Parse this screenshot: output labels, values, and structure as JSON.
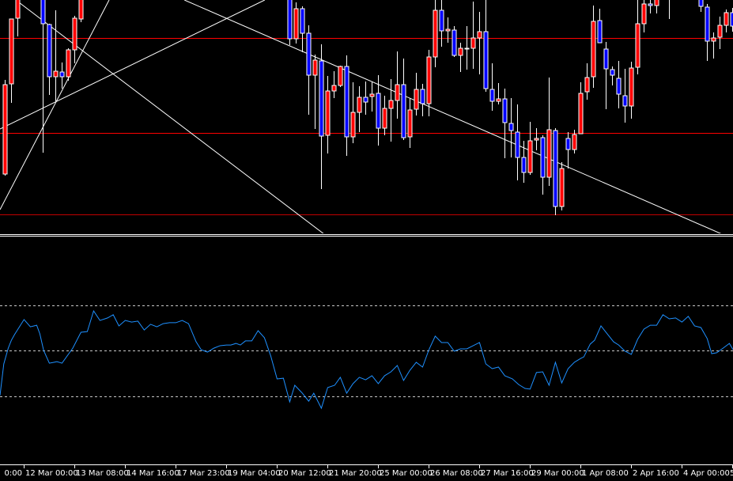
{
  "chart_data": [
    {
      "type": "candlestick",
      "title": "",
      "note": "prices in relative units (no price scale visible); bars indexed left to right",
      "colors": {
        "bull": "#ff0000",
        "bear": "#0000ff",
        "wick": "#ffffff",
        "outline": "#ffffff",
        "background": "#000000"
      },
      "ylim": [
        0,
        300
      ],
      "candles": [
        [
          0,
          80,
          199,
          78,
          193
        ],
        [
          1,
          194,
          276,
          170,
          276
        ],
        [
          2,
          277,
          310,
          254,
          305
        ],
        [
          6,
          310,
          315,
          107,
          270
        ],
        [
          7,
          269,
          270,
          180,
          203
        ],
        [
          8,
          203,
          287,
          172,
          210
        ],
        [
          9,
          209,
          221,
          188,
          203
        ],
        [
          10,
          203,
          239,
          198,
          237
        ],
        [
          11,
          237,
          280,
          220,
          277
        ],
        [
          12,
          276,
          310,
          272,
          305
        ],
        [
          45,
          310,
          315,
          243,
          251
        ],
        [
          46,
          251,
          297,
          245,
          289
        ],
        [
          47,
          289,
          292,
          234,
          258
        ],
        [
          48,
          258,
          268,
          155,
          205
        ],
        [
          49,
          205,
          231,
          137,
          224
        ],
        [
          50,
          223,
          244,
          61,
          128
        ],
        [
          51,
          129,
          204,
          106,
          185
        ],
        [
          52,
          185,
          210,
          176,
          192
        ],
        [
          53,
          192,
          217,
          190,
          216
        ],
        [
          54,
          216,
          230,
          103,
          127
        ],
        [
          55,
          127,
          196,
          119,
          158
        ],
        [
          56,
          158,
          191,
          133,
          177
        ],
        [
          57,
          177,
          197,
          155,
          171
        ],
        [
          58,
          178,
          197,
          159,
          181
        ],
        [
          59,
          182,
          205,
          116,
          138
        ],
        [
          60,
          138,
          179,
          129,
          163
        ],
        [
          61,
          163,
          200,
          121,
          173
        ],
        [
          62,
          173,
          235,
          150,
          193
        ],
        [
          63,
          193,
          226,
          123,
          126
        ],
        [
          64,
          127,
          176,
          113,
          161
        ],
        [
          65,
          162,
          208,
          154,
          187
        ],
        [
          66,
          187,
          194,
          153,
          169
        ],
        [
          67,
          169,
          237,
          153,
          228
        ],
        [
          68,
          228,
          305,
          215,
          287
        ],
        [
          69,
          287,
          305,
          241,
          261
        ],
        [
          70,
          261,
          278,
          246,
          263
        ],
        [
          71,
          262,
          267,
          228,
          230
        ],
        [
          72,
          230,
          246,
          209,
          239
        ],
        [
          73,
          239,
          267,
          212,
          239
        ],
        [
          74,
          239,
          298,
          213,
          252
        ],
        [
          75,
          252,
          285,
          206,
          260
        ],
        [
          76,
          260,
          305,
          184,
          188
        ],
        [
          77,
          187,
          220,
          160,
          172
        ],
        [
          78,
          172,
          195,
          168,
          175
        ],
        [
          79,
          175,
          188,
          100,
          145
        ],
        [
          80,
          144,
          176,
          101,
          135
        ],
        [
          81,
          133,
          168,
          72,
          101
        ],
        [
          82,
          101,
          122,
          69,
          82
        ],
        [
          83,
          82,
          146,
          79,
          122
        ],
        [
          84,
          123,
          138,
          110,
          125
        ],
        [
          85,
          126,
          129,
          54,
          76
        ],
        [
          86,
          76,
          202,
          65,
          136
        ],
        [
          87,
          135,
          138,
          28,
          39
        ],
        [
          88,
          39,
          95,
          34,
          87
        ],
        [
          89,
          125,
          133,
          87,
          111
        ],
        [
          90,
          111,
          136,
          106,
          130
        ],
        [
          91,
          131,
          196,
          131,
          182
        ],
        [
          92,
          184,
          220,
          174,
          202
        ],
        [
          93,
          203,
          293,
          189,
          273
        ],
        [
          94,
          274,
          289,
          246,
          246
        ],
        [
          95,
          238,
          247,
          162,
          213
        ],
        [
          96,
          212,
          216,
          192,
          205
        ],
        [
          97,
          201,
          223,
          163,
          181
        ],
        [
          98,
          179,
          213,
          145,
          166
        ],
        [
          99,
          166,
          222,
          150,
          214
        ],
        [
          100,
          215,
          305,
          206,
          270
        ],
        [
          101,
          270,
          305,
          259,
          295
        ],
        [
          102,
          295,
          305,
          283,
          293
        ],
        [
          103,
          293,
          310,
          283,
          305
        ],
        [
          105,
          305,
          315,
          276,
          310
        ],
        [
          110,
          305,
          310,
          285,
          292
        ],
        [
          111,
          291,
          295,
          223,
          248
        ],
        [
          112,
          248,
          259,
          226,
          252
        ],
        [
          113,
          253,
          279,
          238,
          268
        ],
        [
          114,
          268,
          288,
          259,
          284
        ],
        [
          115,
          284,
          290,
          260,
          267
        ]
      ],
      "horizontal_lines": [
        {
          "price": 252,
          "color": "#ff0000"
        },
        {
          "price": 132,
          "color": "#ff0000"
        },
        {
          "price": 29,
          "color": "#c00000"
        }
      ],
      "trendlines": [
        {
          "from": [
            -0.75,
            35
          ],
          "to": [
            16.5,
            300
          ],
          "color": "#ffffff"
        },
        {
          "from": [
            -0.75,
            137
          ],
          "to": [
            41.1,
            300
          ],
          "color": "#ffffff"
        },
        {
          "from": [
            1.75,
            300
          ],
          "to": [
            50.5,
            4
          ],
          "color": "#ffffff"
        },
        {
          "from": [
            28.4,
            300
          ],
          "to": [
            113.4,
            4
          ],
          "color": "#ffffff"
        }
      ]
    },
    {
      "type": "line",
      "title": "",
      "series_color": "#1e90ff",
      "ylim": [
        20,
        80
      ],
      "levels": [
        70,
        50,
        30
      ],
      "points": [
        [
          0,
          30.2
        ],
        [
          0.6,
          44.1
        ],
        [
          1.3,
          51.0
        ],
        [
          1.8,
          54.5
        ],
        [
          2.3,
          57.0
        ],
        [
          3.8,
          63.6
        ],
        [
          4.8,
          60.4
        ],
        [
          5.8,
          61.1
        ],
        [
          6.3,
          57.3
        ],
        [
          6.9,
          50.0
        ],
        [
          7.8,
          44.4
        ],
        [
          8.5,
          44.8
        ],
        [
          9,
          45.1
        ],
        [
          9.8,
          44.4
        ],
        [
          11.5,
          51.0
        ],
        [
          12.8,
          58.0
        ],
        [
          13.8,
          58.3
        ],
        [
          14.8,
          67.4
        ],
        [
          15.8,
          63.2
        ],
        [
          17,
          64.3
        ],
        [
          17.9,
          65.7
        ],
        [
          18.8,
          60.8
        ],
        [
          19.8,
          63.2
        ],
        [
          20.8,
          62.5
        ],
        [
          21.8,
          62.9
        ],
        [
          22.8,
          59.0
        ],
        [
          23.8,
          61.5
        ],
        [
          24.8,
          60.4
        ],
        [
          25.8,
          61.8
        ],
        [
          26.8,
          62.2
        ],
        [
          27.8,
          62.2
        ],
        [
          28.8,
          63.2
        ],
        [
          29.8,
          61.8
        ],
        [
          31,
          53.8
        ],
        [
          31.8,
          50.3
        ],
        [
          32.8,
          49.3
        ],
        [
          33.8,
          51.0
        ],
        [
          34.8,
          52.1
        ],
        [
          35.8,
          52.4
        ],
        [
          36.5,
          52.4
        ],
        [
          37.3,
          53.1
        ],
        [
          38,
          52.4
        ],
        [
          38.8,
          54.2
        ],
        [
          39.8,
          54.2
        ],
        [
          40.8,
          58.7
        ],
        [
          41.8,
          55.6
        ],
        [
          42.8,
          47.6
        ],
        [
          43.8,
          37.5
        ],
        [
          44.8,
          37.8
        ],
        [
          45.8,
          27.4
        ],
        [
          46.6,
          34.7
        ],
        [
          47.8,
          31.2
        ],
        [
          48.8,
          27.7
        ],
        [
          49.6,
          31.2
        ],
        [
          50.8,
          24.6
        ],
        [
          51.8,
          33.7
        ],
        [
          52.9,
          34.7
        ],
        [
          53.8,
          38.2
        ],
        [
          54.8,
          31.2
        ],
        [
          55.8,
          35.4
        ],
        [
          56.8,
          38.2
        ],
        [
          57.8,
          37.1
        ],
        [
          58.8,
          38.9
        ],
        [
          59.8,
          35.4
        ],
        [
          60.8,
          38.9
        ],
        [
          61.8,
          40.6
        ],
        [
          62.8,
          43.4
        ],
        [
          63.8,
          36.8
        ],
        [
          64.8,
          41.3
        ],
        [
          65.8,
          44.8
        ],
        [
          66.8,
          42.7
        ],
        [
          67.8,
          50.3
        ],
        [
          68.8,
          56.3
        ],
        [
          69.8,
          53.5
        ],
        [
          70.8,
          53.5
        ],
        [
          71.8,
          49.7
        ],
        [
          72.8,
          50.7
        ],
        [
          73.8,
          50.7
        ],
        [
          74.8,
          52.1
        ],
        [
          75.8,
          53.5
        ],
        [
          76.8,
          44.1
        ],
        [
          77.8,
          42.0
        ],
        [
          78.8,
          42.7
        ],
        [
          79.8,
          38.9
        ],
        [
          81,
          37.5
        ],
        [
          82,
          35.0
        ],
        [
          83,
          33.3
        ],
        [
          83.8,
          33.0
        ],
        [
          84.8,
          40.3
        ],
        [
          85.8,
          40.6
        ],
        [
          86.8,
          34.7
        ],
        [
          87.8,
          44.8
        ],
        [
          88.8,
          35.7
        ],
        [
          89.8,
          42.0
        ],
        [
          90.8,
          44.8
        ],
        [
          91.8,
          46.5
        ],
        [
          92.3,
          47.2
        ],
        [
          93.3,
          52.8
        ],
        [
          94,
          54.5
        ],
        [
          95,
          60.8
        ],
        [
          96,
          57.3
        ],
        [
          97,
          53.8
        ],
        [
          97.8,
          52.4
        ],
        [
          98.8,
          49.7
        ],
        [
          99.8,
          48.3
        ],
        [
          100.8,
          54.9
        ],
        [
          101.8,
          59.4
        ],
        [
          102.8,
          61.1
        ],
        [
          103.8,
          61.1
        ],
        [
          104.8,
          65.7
        ],
        [
          105.8,
          63.9
        ],
        [
          106.8,
          64.3
        ],
        [
          107.8,
          62.5
        ],
        [
          108.8,
          65.0
        ],
        [
          109.8,
          60.8
        ],
        [
          110.8,
          60.1
        ],
        [
          111.8,
          55.2
        ],
        [
          112.5,
          48.6
        ],
        [
          113.3,
          49.0
        ],
        [
          114.3,
          51.0
        ],
        [
          115.3,
          53.1
        ],
        [
          115.9,
          50.3
        ]
      ]
    }
  ],
  "x_axis": {
    "first_partial_label": "0:00",
    "labels": [
      "12 Mar 00:00",
      "13 Mar 08:00",
      "14 Mar 16:00",
      "17 Mar 23:00",
      "19 Mar 04:00",
      "20 Mar 12:00",
      "21 Mar 20:00",
      "25 Mar 00:00",
      "26 Mar 08:00",
      "27 Mar 16:00",
      "29 Mar 00:00",
      "1 Apr 08:00",
      "2 Apr 16:00",
      "4 Apr 00:00"
    ],
    "last_partial_label": "5"
  }
}
